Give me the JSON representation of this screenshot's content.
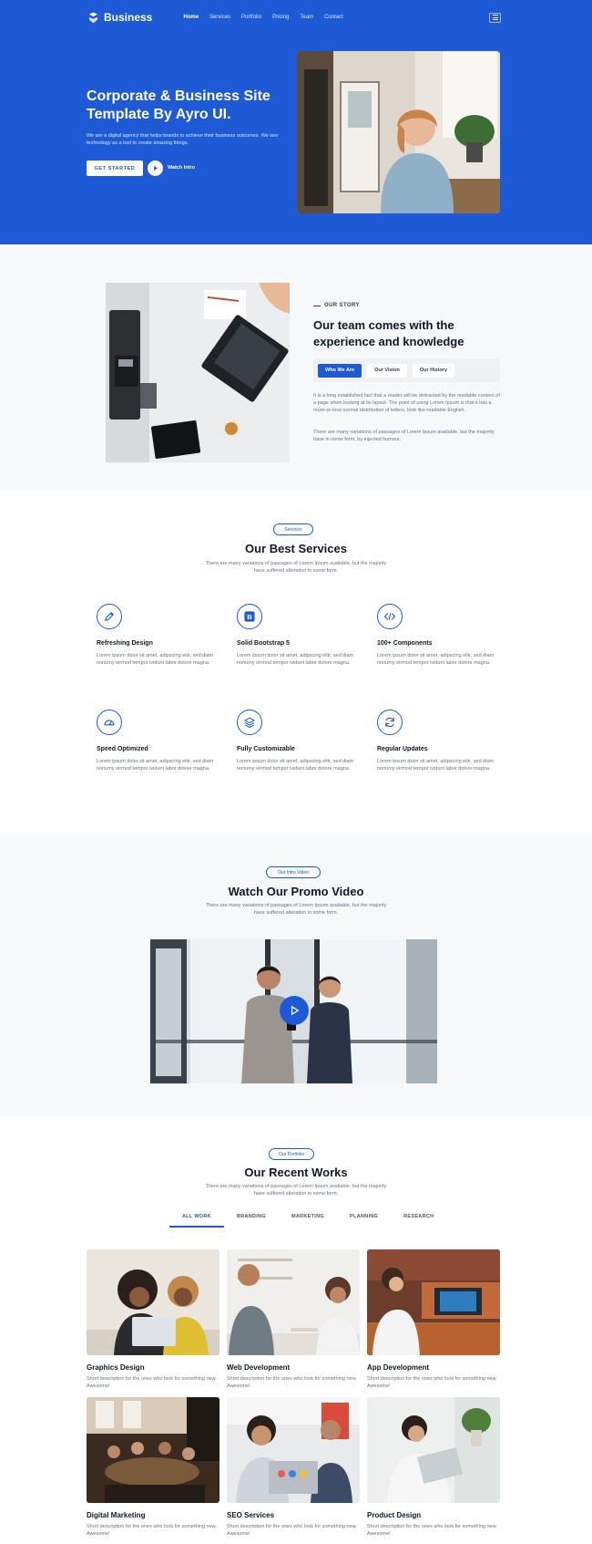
{
  "colors": {
    "brand": "#1e5ad6",
    "text": "#111827",
    "muted": "#6b7280"
  },
  "nav": {
    "logo": "Business",
    "items": [
      "Home",
      "Services",
      "Portfolio",
      "Pricing",
      "Team",
      "Contact"
    ],
    "active": "Home"
  },
  "hero": {
    "title": "Corporate & Business Site Template By Ayro UI.",
    "description": "We are a digital agency that helps brands to achieve their business outcomes. We see technology as a tool to create amazing things.",
    "cta": "GET STARTED",
    "watch": "Watch Intro"
  },
  "story": {
    "eyebrow": "OUR STORY",
    "title": "Our team comes with the experience and knowledge",
    "tabs": [
      "Who We Are",
      "Our Vision",
      "Our History"
    ],
    "p1": "It is a long established fact that a reader will be distracted by the readable content of a page when looking at its layout. The point of using Lorem Ipsum is that it has a more-or-less normal distribution of letters, look like readable English.",
    "p2": "There are many variations of passages of Lorem Ipsum available, but the majority have in some form, by injected humour."
  },
  "services": {
    "pill": "Services",
    "title": "Our Best Services",
    "subtitle": "There are many variations of passages of Lorem Ipsum available, but the majority have suffered alteration in some form.",
    "items": [
      {
        "title": "Refreshing Design",
        "icon": "pencil-icon",
        "desc": "Lorem ipsum dolor sit amet, adipscing elitr, sed diam nonumy eirmod tempor ividunt labor dolore magna."
      },
      {
        "title": "Solid Bootstrap 5",
        "icon": "bootstrap-icon",
        "desc": "Lorem ipsum dolor sit amet, adipscing elitr, sed diam nonumy eirmod tempor ividunt labor dolore magna."
      },
      {
        "title": "100+ Components",
        "icon": "code-icon",
        "desc": "Lorem ipsum dolor sit amet, adipscing elitr, sed diam nonumy eirmod tempor ividunt labor dolore magna."
      },
      {
        "title": "Speed Optimized",
        "icon": "speedometer-icon",
        "desc": "Lorem ipsum dolor sit amet, adipscing elitr, sed diam nonumy eirmod tempor ividunt labor dolore magna."
      },
      {
        "title": "Fully Customizable",
        "icon": "layers-icon",
        "desc": "Lorem ipsum dolor sit amet, adipscing elitr, sed diam nonumy eirmod tempor ividunt labor dolore magna."
      },
      {
        "title": "Regular Updates",
        "icon": "refresh-icon",
        "desc": "Lorem ipsum dolor sit amet, adipscing elitr, sed diam nonumy eirmod tempor ividunt labor dolore magna."
      }
    ]
  },
  "video": {
    "pill": "Our Intro Video",
    "title": "Watch Our Promo Video",
    "subtitle": "There are many variations of passages of Lorem Ipsum available, but the majority have suffered alteration in some form."
  },
  "works": {
    "pill": "Our Portfolio",
    "title": "Our Recent Works",
    "subtitle": "There are many variations of passages of Lorem Ipsum available, but the majority have suffered alteration in some form.",
    "filters": [
      "ALL WORK",
      "BRANDING",
      "MARKETING",
      "PLANNING",
      "RESEARCH"
    ],
    "active_filter": "ALL WORK",
    "items": [
      {
        "title": "Graphics Design",
        "desc": "Short description for the ones who look for something new. Awesome!"
      },
      {
        "title": "Web Development",
        "desc": "Short description for the ones who look for something new. Awesome!"
      },
      {
        "title": "App Development",
        "desc": "Short description for the ones who look for something new. Awesome!"
      },
      {
        "title": "Digital Marketing",
        "desc": "Short description for the ones who look for something new. Awesome!"
      },
      {
        "title": "SEO Services",
        "desc": "Short description for the ones who look for something new. Awesome!"
      },
      {
        "title": "Product Design",
        "desc": "Short description for the ones who look for something new. Awesome!"
      }
    ]
  }
}
